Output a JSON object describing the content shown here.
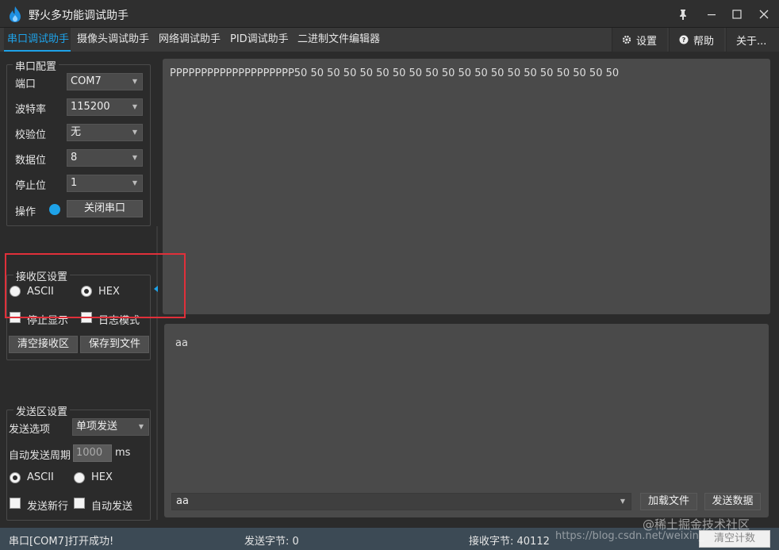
{
  "window": {
    "title": "野火多功能调试助手"
  },
  "tabs": [
    {
      "label": "串口调试助手",
      "active": true
    },
    {
      "label": "摄像头调试助手"
    },
    {
      "label": "网络调试助手"
    },
    {
      "label": "PID调试助手"
    },
    {
      "label": "二进制文件编辑器"
    }
  ],
  "toolbar": {
    "settings": "设置",
    "help": "帮助",
    "about": "关于..."
  },
  "serial_config": {
    "title": "串口配置",
    "port": {
      "label": "端口",
      "value": "COM7"
    },
    "baud": {
      "label": "波特率",
      "value": "115200"
    },
    "parity": {
      "label": "校验位",
      "value": "无"
    },
    "databits": {
      "label": "数据位",
      "value": "8"
    },
    "stopbits": {
      "label": "停止位",
      "value": "1"
    },
    "operation": {
      "label": "操作",
      "button": "关闭串口",
      "status_color": "#1ea2e8"
    }
  },
  "recv_settings": {
    "title": "接收区设置",
    "ascii": "ASCII",
    "hex": "HEX",
    "selected": "HEX",
    "stop_display": "停止显示",
    "log_mode": "日志模式",
    "clear_btn": "清空接收区",
    "save_btn": "保存到文件"
  },
  "send_settings": {
    "title": "发送区设置",
    "option_label": "发送选项",
    "option_value": "单项发送",
    "period_label": "自动发送周期",
    "period_value": "1000",
    "period_unit": "ms",
    "ascii": "ASCII",
    "hex": "HEX",
    "selected": "ASCII",
    "newline": "发送新行",
    "auto_send": "自动发送"
  },
  "recv_area": {
    "text": "PPPPPPPPPPPPPPPPPPPP50 50 50 50 50 50 50 50 50 50 50 50 50 50 50 50 50 50 50 50"
  },
  "send_area": {
    "text": "aa",
    "combo_value": "aa",
    "load_btn": "加载文件",
    "send_btn": "发送数据"
  },
  "status": {
    "message": "串口[COM7]打开成功!",
    "sent": "发送字节: 0",
    "received": "接收字节: 40112",
    "clear_count": "清空计数"
  },
  "watermark": "@稀土掘金技术社区",
  "watermark_url": "https://blog.csdn.net/weixin_"
}
